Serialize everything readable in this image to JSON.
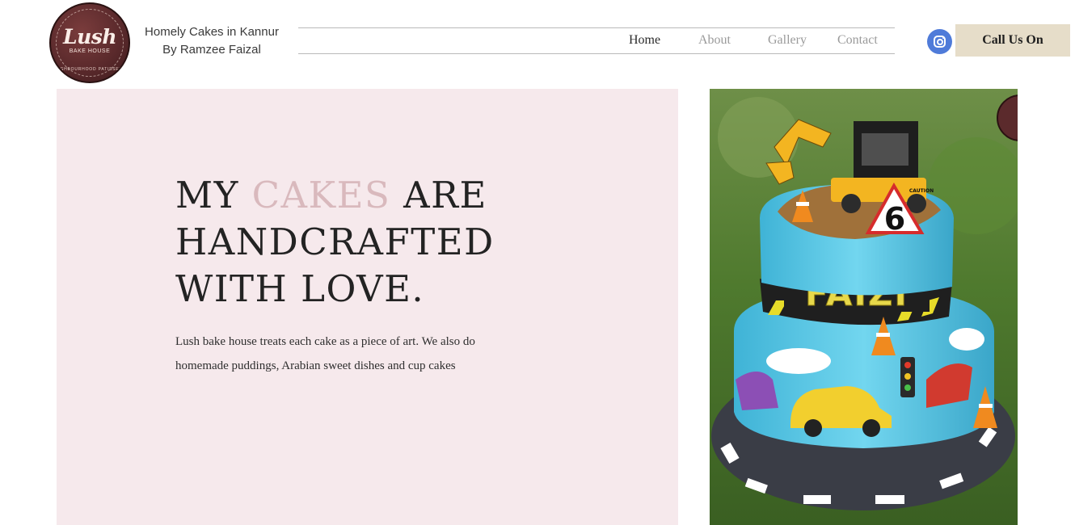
{
  "logo": {
    "script_text": "Lush",
    "sub_text": "BAKE HOUSE",
    "ring_text": "NEIGHBOURHOOD PATISSERIE"
  },
  "header": {
    "tagline_line1": "Homely Cakes in Kannur",
    "tagline_line2": "By Ramzee Faizal"
  },
  "nav": {
    "items": [
      {
        "label": "Home",
        "active": true
      },
      {
        "label": "About",
        "active": false
      },
      {
        "label": "Gallery",
        "active": false
      },
      {
        "label": "Contact",
        "active": false
      }
    ]
  },
  "social": {
    "icon": "instagram-icon"
  },
  "cta": {
    "label": "Call Us On"
  },
  "hero": {
    "headline_part1": "MY ",
    "headline_accent": "CAKES",
    "headline_part2": " ARE HANDCRAFTED WITH LOVE.",
    "body_line1": "Lush bake house treats each cake as a piece of art.  We also do",
    "body_line2": "homemade puddings, Arabian sweet dishes and cup cakes"
  },
  "photo": {
    "cake_name": "FAIZI",
    "age_number": "6",
    "sign_text": "CAUTION"
  },
  "colors": {
    "hero_background": "#f6e9ec",
    "accent_text": "#d9b9bd",
    "cta_background": "#e6ddc9",
    "logo_background": "#5b2a2c",
    "instagram_blue": "#4f7bd9"
  }
}
